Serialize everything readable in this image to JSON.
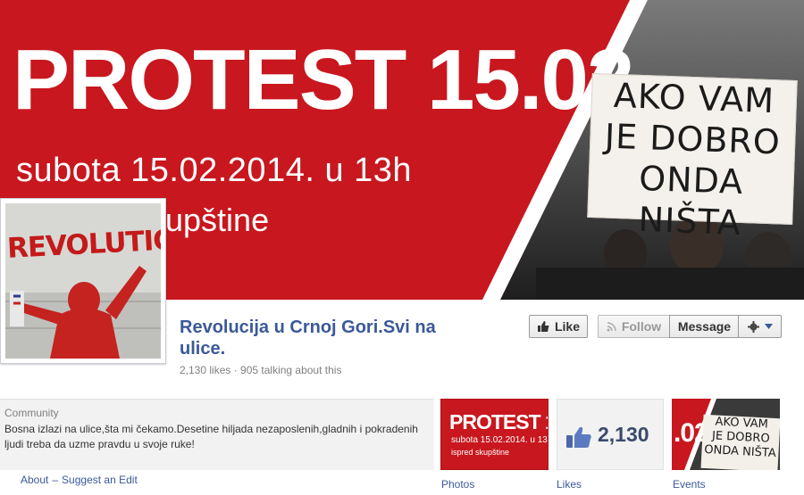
{
  "cover": {
    "title": "PROTEST 15.02",
    "date_line": "subota 15.02.2014. u 13h",
    "place_line": "upštine",
    "sign_lines": [
      "AKO VAM",
      "JE DOBRO",
      "ONDA NIŠTA"
    ]
  },
  "profile": {
    "graffiti": "REVOLUTIO"
  },
  "page": {
    "name": "Revolucija u Crnoj Gori.Svi na ulice.",
    "stats": "2,130 likes · 905 talking about this"
  },
  "actions": {
    "like": "Like",
    "follow": "Follow",
    "message": "Message"
  },
  "about": {
    "category": "Community",
    "description": "Bosna izlazi na ulice,šta mi čekamo.Desetine hiljada nezaposlenih,gladnih i pokradenih ljudi treba da uzme pravdu u svoje ruke!",
    "about_link": "About",
    "separator": "–",
    "suggest_link": "Suggest an Edit"
  },
  "tiles": {
    "photos": {
      "label": "Photos",
      "title": "PROTEST 1",
      "date": "subota 15.02.2014. u 13",
      "place": "ispred skupštine"
    },
    "likes": {
      "label": "Likes",
      "count": "2,130"
    },
    "events": {
      "label": "Events",
      "number": ".02",
      "sign_lines": [
        "AKO VAM",
        "JE DOBRO",
        "ONDA NIŠTA"
      ]
    }
  },
  "colors": {
    "cover_red": "#c8171e",
    "link_blue": "#3b5998"
  }
}
